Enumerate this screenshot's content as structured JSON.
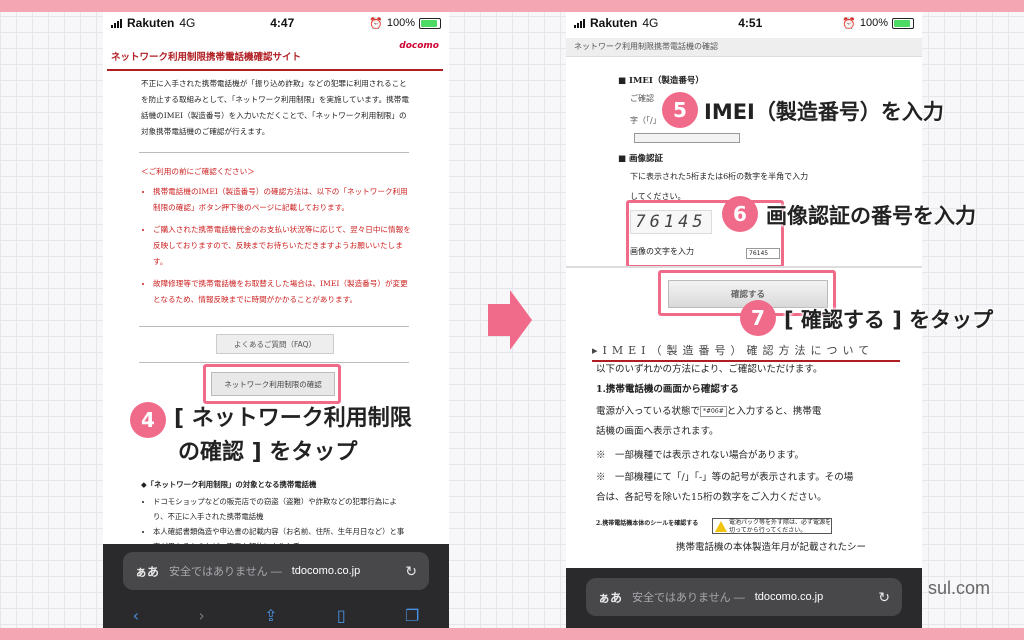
{
  "phone1": {
    "status": {
      "carrier": "Rakuten",
      "network": "4G",
      "time": "4:47",
      "battery": "100%"
    },
    "header": {
      "site_title": "ネットワーク利用制限携帯電話機確認サイト",
      "logo": "docomo"
    },
    "intro": "不正に入手された携帯電話機が「振り込め詐欺」などの犯罪に利用されることを防止する取組みとして、「ネットワーク利用制限」を実施しています。携帯電話機のIMEI（製造番号）を入力いただくことで、「ネットワーク利用制限」の対象携帯電話機のご確認が行えます。",
    "notes_heading": "＜ご利用の前にご確認ください＞",
    "notes": [
      "携帯電話機のIMEI（製造番号）の確認方法は、以下の「ネットワーク利用制限の確認」ボタン押下後のページに記載しております。",
      "ご購入された携帯電話機代金のお支払い状況等に応じて、翌々日中に情報を反映しておりますので、反映までお待ちいただきますようお願いいたします。",
      "故障修理等で携帯電話機をお取替えした場合は、IMEI（製造番号）が変更となるため、情報反映までに時間がかかることがあります。"
    ],
    "faq_button": "よくあるご質問（FAQ）",
    "confirm_button": "ネットワーク利用制限の確認",
    "list_heading": "◆「ネットワーク利用制限」の対象となる携帯電話機",
    "list_items": [
      "ドコモショップなどの販売店での窃盗（盗難）や詐欺などの犯罪行為により、不正に入手された携帯電話機",
      "本人確認書類偽造や申込書の記載内容（お名前、住所、生年月日など）と事実が異なるものなど、不正な契約により入手"
    ],
    "url_bar": {
      "aa": "ぁあ",
      "warning": "安全ではありません —",
      "domain": "tdocomo.co.jp"
    }
  },
  "phone2": {
    "status": {
      "carrier": "Rakuten",
      "network": "4G",
      "time": "4:51",
      "battery": "100%"
    },
    "header": "ネットワーク利用制限携帯電話機の確認",
    "imei_label": "■ IMEI（製造番号）",
    "imei_faded": [
      "ご確認",
      "字（「/」"
    ],
    "captcha_label": "■ 画像認証",
    "captcha_text_1": "下に表示された5桁または6桁の数字を半角で入力",
    "captcha_text_2": "してください。",
    "captcha_image": "76145",
    "captcha_input_label": "画像の文字を入力",
    "captcha_input_value": "76145",
    "confirm_button": "確認する",
    "imei_method_title": "▸IMEI（製造番号）確認方法について",
    "intro": "以下のいずれかの方法により、ご確認いただけます。",
    "method1_title": "1.携帯電話機の画面から確認する",
    "method1_text_a": "電源が入っている状態で",
    "method1_key": "*#06#",
    "method1_text_b": "と入力すると、携帯電",
    "method1_text_c": "話機の画面へ表示されます。",
    "note1": "※　一部機種では表示されない場合があります。",
    "note2a": "※　一部機種にて「/」「-」等の記号が表示されます。その場",
    "note2b": "合は、各記号を除いた15桁の数字をご入力ください。",
    "method2_title": "2.携帯電話機本体のシールを確認する",
    "warning_box": "電池パック等を外す際は、必ず電源を切ってから行ってください。",
    "method2_text": "携帯電話機の本体製造年月が記載されたシー",
    "url_bar": {
      "aa": "ぁあ",
      "warning": "安全ではありません —",
      "domain": "tdocomo.co.jp"
    }
  },
  "callouts": {
    "step4_number": "4",
    "step4_line1": "[ ネットワーク利用制限",
    "step4_line2": "の確認 ] をタップ",
    "step5_number": "5",
    "step5_text": "IMEI（製造番号）を入力",
    "step6_number": "6",
    "step6_text": "画像認証の番号を入力",
    "step7_number": "7",
    "step7_text": "[ 確認する ] をタップ"
  },
  "watermark": "sul.com",
  "colors": {
    "accent_pink": "#f06b8a",
    "docomo_red": "#b01e23",
    "note_red": "#cc1f1f",
    "band_pink": "#f4a6b3"
  }
}
